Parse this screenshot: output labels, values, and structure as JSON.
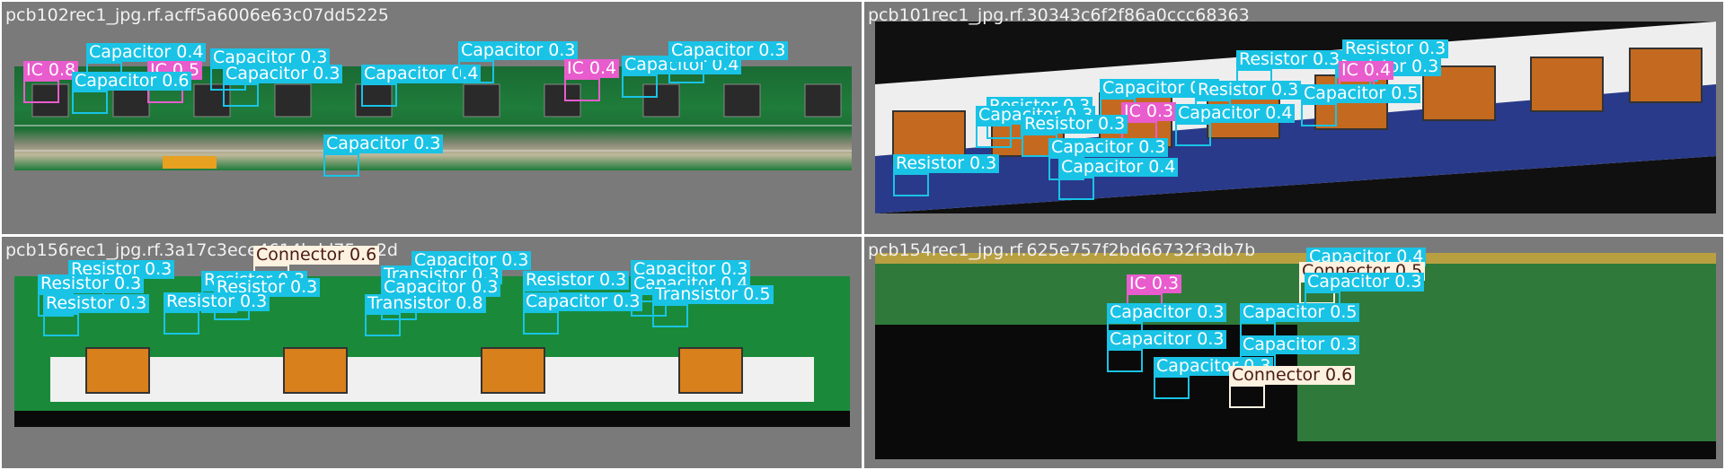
{
  "panels": [
    {
      "title": "pcb102rec1_jpg.rf.acff5a6006e63c07dd5225"
    },
    {
      "title": "pcb101rec1_jpg.rf.30343c6f2f86a0ccc68363"
    },
    {
      "title": "pcb156rec1_jpg.rf.3a17c3ece4614bdd75aa2d"
    },
    {
      "title": "pcb154rec1_jpg.rf.625e757f2bd66732f3db7b"
    }
  ],
  "colors": {
    "capacitor": "#19c3e6",
    "resistor": "#19c3e6",
    "ic": "#e85ccd",
    "transistor": "#19c3e6",
    "connector": "#fdf1e0",
    "panel_bg": "#7a7a7a"
  },
  "detections": {
    "p1": [
      {
        "label": "Capacitor 0.4",
        "cls": "cap"
      },
      {
        "label": "IC 0.8",
        "cls": "ic"
      },
      {
        "label": "IC 0.5",
        "cls": "ic"
      },
      {
        "label": "Capacitor 0.6",
        "cls": "cap"
      },
      {
        "label": "Capacitor 0.3",
        "cls": "cap"
      },
      {
        "label": "Capacitor 0.3",
        "cls": "cap"
      },
      {
        "label": "Capacitor 0.4",
        "cls": "cap"
      },
      {
        "label": "Capacitor 0.3",
        "cls": "cap"
      },
      {
        "label": "Capacitor 0.3",
        "cls": "cap"
      },
      {
        "label": "IC 0.4",
        "cls": "ic"
      },
      {
        "label": "Capacitor 0.4",
        "cls": "cap"
      },
      {
        "label": "Capacitor 0.3",
        "cls": "cap"
      }
    ],
    "p2": [
      {
        "label": "Resistor 0.3",
        "cls": "res"
      },
      {
        "label": "Resistor 0.3",
        "cls": "res"
      },
      {
        "label": "Resistor 0.3",
        "cls": "res"
      },
      {
        "label": "Capacitor 0.3",
        "cls": "cap"
      },
      {
        "label": "Resistor 0.3",
        "cls": "res"
      },
      {
        "label": "IC 0.4",
        "cls": "ic"
      },
      {
        "label": "Capacitor 0.5",
        "cls": "cap"
      },
      {
        "label": "Resistor 0.3",
        "cls": "res"
      },
      {
        "label": "IC 0.3",
        "cls": "ic"
      },
      {
        "label": "Capacitor 0.4",
        "cls": "cap"
      },
      {
        "label": "Capacitor 0.3",
        "cls": "cap"
      },
      {
        "label": "Resistor 0.3",
        "cls": "res"
      },
      {
        "label": "Capacitor 0.3",
        "cls": "cap"
      },
      {
        "label": "Resistor 0.3",
        "cls": "res"
      },
      {
        "label": "Capacitor 0.4",
        "cls": "cap"
      }
    ],
    "p3": [
      {
        "label": "Connector 0.6",
        "cls": "con"
      },
      {
        "label": "Capacitor 0.3",
        "cls": "cap"
      },
      {
        "label": "Resistor 0.3",
        "cls": "res"
      },
      {
        "label": "Resistor 0.3",
        "cls": "res"
      },
      {
        "label": "Resistor 0.3",
        "cls": "res"
      },
      {
        "label": "Resistor 0.3",
        "cls": "res"
      },
      {
        "label": "Resistor 0.3",
        "cls": "res"
      },
      {
        "label": "Transistor 0.3",
        "cls": "tr"
      },
      {
        "label": "Capacitor 0.3",
        "cls": "cap"
      },
      {
        "label": "Resistor 0.3",
        "cls": "res"
      },
      {
        "label": "Capacitor 0.3",
        "cls": "cap"
      },
      {
        "label": "Capacitor 0.4",
        "cls": "cap"
      },
      {
        "label": "Transistor 0.8",
        "cls": "tr"
      },
      {
        "label": "Capacitor 0.3",
        "cls": "cap"
      },
      {
        "label": "Transistor 0.5",
        "cls": "tr"
      },
      {
        "label": "Resistor 0.3",
        "cls": "res"
      }
    ],
    "p4": [
      {
        "label": "Capacitor 0.4",
        "cls": "cap"
      },
      {
        "label": "Connector 0.5",
        "cls": "con"
      },
      {
        "label": "IC 0.3",
        "cls": "ic"
      },
      {
        "label": "Capacitor 0.3",
        "cls": "cap"
      },
      {
        "label": "Capacitor 0.3",
        "cls": "cap"
      },
      {
        "label": "Capacitor 0.5",
        "cls": "cap"
      },
      {
        "label": "Capacitor 0.3",
        "cls": "cap"
      },
      {
        "label": "Capacitor 0.3",
        "cls": "cap"
      },
      {
        "label": "Capacitor 0.3",
        "cls": "cap"
      },
      {
        "label": "Connector 0.6",
        "cls": "con"
      }
    ]
  }
}
